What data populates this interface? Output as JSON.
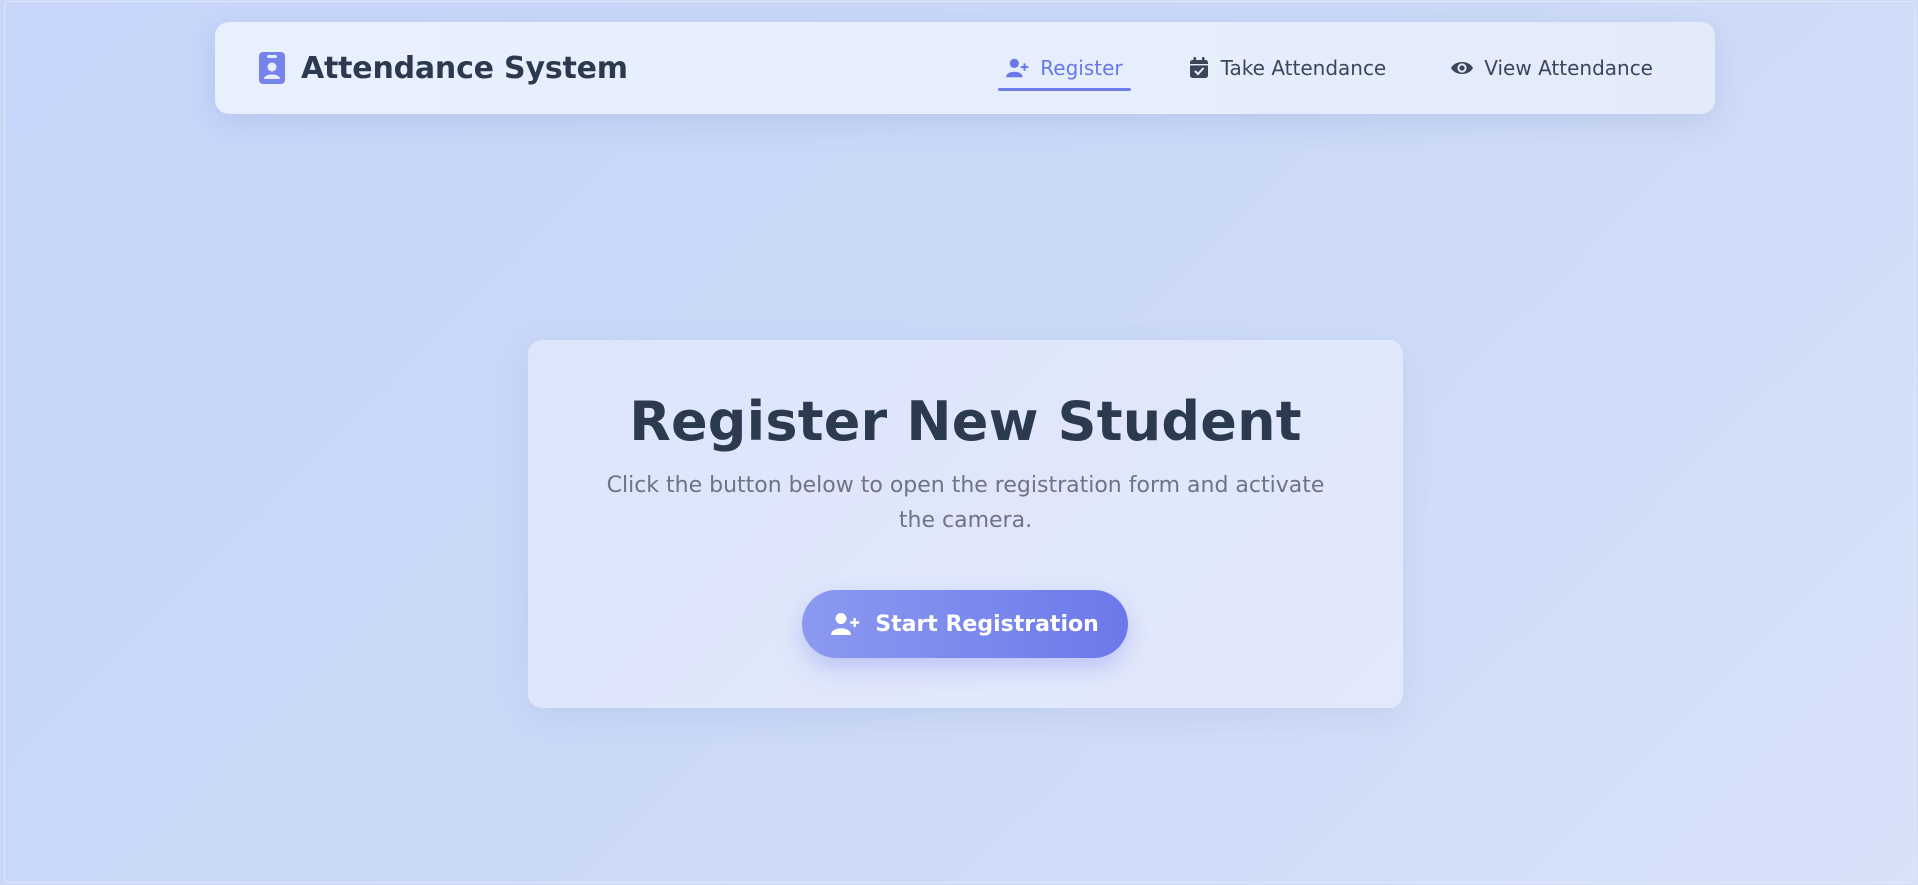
{
  "app": {
    "title": "Attendance System",
    "icon": "id-badge-icon",
    "accent_color": "#6f7ee9",
    "text_color": "#2c3a4f"
  },
  "nav": {
    "items": [
      {
        "label": "Register",
        "icon": "user-plus-icon",
        "active": true
      },
      {
        "label": "Take Attendance",
        "icon": "calendar-check-icon",
        "active": false
      },
      {
        "label": "View Attendance",
        "icon": "eye-icon",
        "active": false
      }
    ]
  },
  "main": {
    "heading": "Register New Student",
    "description": "Click the button below to open the registration form and activate the camera.",
    "button": {
      "label": "Start Registration",
      "icon": "user-plus-icon"
    }
  }
}
